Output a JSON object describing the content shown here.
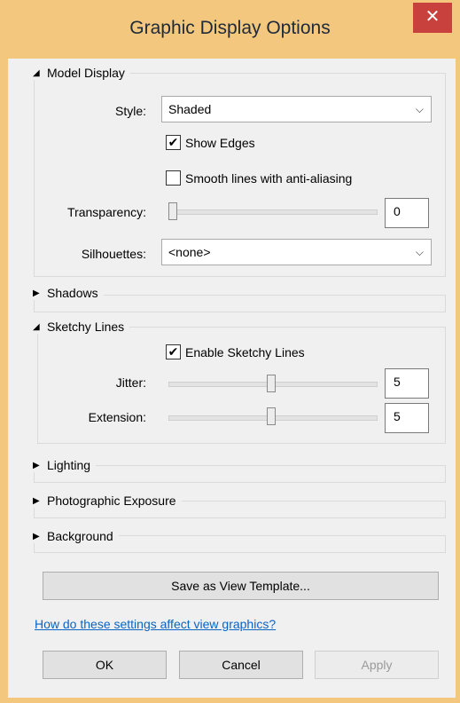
{
  "window": {
    "title": "Graphic Display Options",
    "close_symbol": "✕"
  },
  "model_display": {
    "header": "Model Display",
    "style_label": "Style:",
    "style_value": "Shaded",
    "show_edges_label": "Show Edges",
    "show_edges_checked": true,
    "smooth_lines_label": "Smooth lines with anti-aliasing",
    "smooth_lines_checked": false,
    "transparency_label": "Transparency:",
    "transparency_value": "0",
    "silhouettes_label": "Silhouettes:",
    "silhouettes_value": "<none>"
  },
  "shadows": {
    "header": "Shadows"
  },
  "sketchy_lines": {
    "header": "Sketchy Lines",
    "enable_label": "Enable Sketchy Lines",
    "enable_checked": true,
    "jitter_label": "Jitter:",
    "jitter_value": "5",
    "extension_label": "Extension:",
    "extension_value": "5"
  },
  "lighting": {
    "header": "Lighting"
  },
  "photographic_exposure": {
    "header": "Photographic Exposure"
  },
  "background": {
    "header": "Background"
  },
  "actions": {
    "save_template_label": "Save as View Template...",
    "help_link": "How do these settings affect view graphics?",
    "ok_label": "OK",
    "cancel_label": "Cancel",
    "apply_label": "Apply"
  },
  "icons": {
    "expanded_arrow": "◢",
    "collapsed_arrow": "▶",
    "dropdown_arrow": "⌵",
    "check_mark": "✔"
  },
  "colors": {
    "accent_frame": "#f3c77d",
    "close_button": "#c9413c",
    "link": "#0b63c4"
  }
}
